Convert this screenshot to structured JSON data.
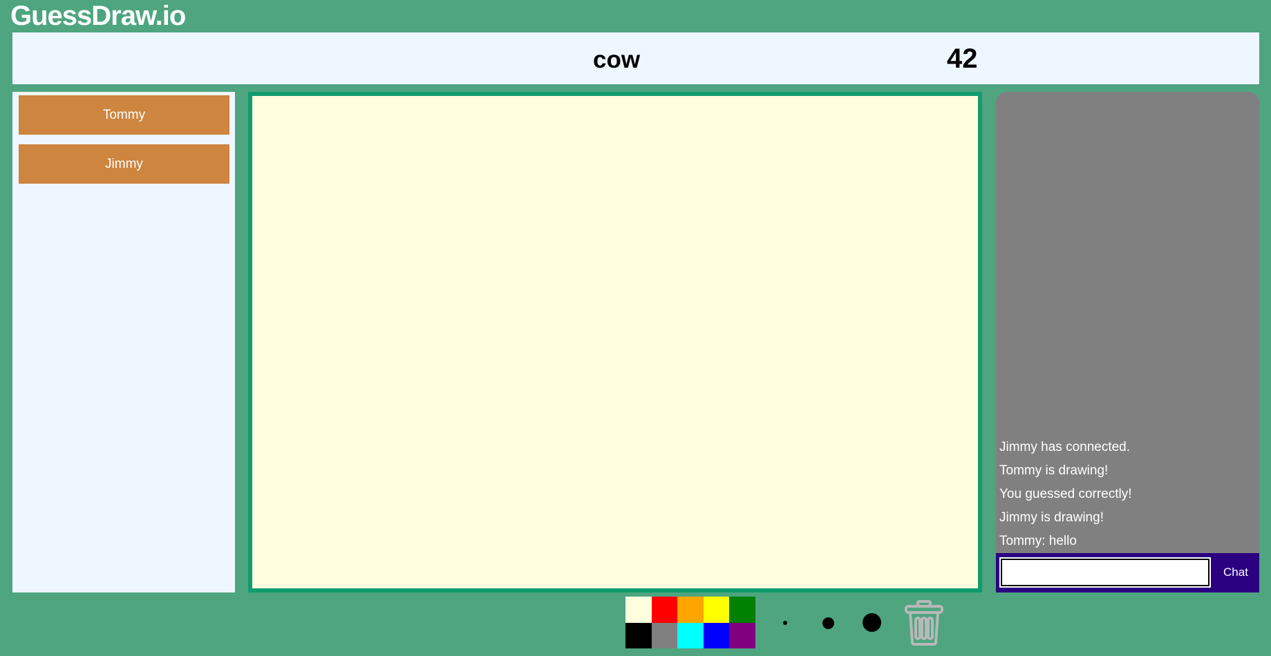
{
  "app": {
    "title": "GuessDraw.io"
  },
  "header": {
    "word": "cow",
    "timer": "42"
  },
  "players": [
    {
      "name": "Tommy"
    },
    {
      "name": "Jimmy"
    }
  ],
  "chat": {
    "messages": [
      "Jimmy has connected.",
      "Tommy is drawing!",
      "You guessed correctly!",
      "Jimmy is drawing!",
      "Tommy: hello"
    ],
    "input_value": "",
    "button_label": "Chat"
  },
  "palette": {
    "colors": [
      "#ffffe0",
      "#ff0000",
      "#ffa500",
      "#ffff00",
      "#008000",
      "#000000",
      "#808080",
      "#00ffff",
      "#0000ff",
      "#800080"
    ]
  },
  "brush_sizes": [
    "small",
    "medium",
    "large"
  ],
  "icons": {
    "trash": "trash-icon"
  },
  "theme": {
    "background": "#4ea57f",
    "panel": "#eef6ff",
    "player_button": "#cd853f",
    "canvas_border": "#119c6e",
    "canvas_fill": "#ffffe0",
    "chat_panel": "#808080",
    "chat_bar": "#2a0081"
  }
}
